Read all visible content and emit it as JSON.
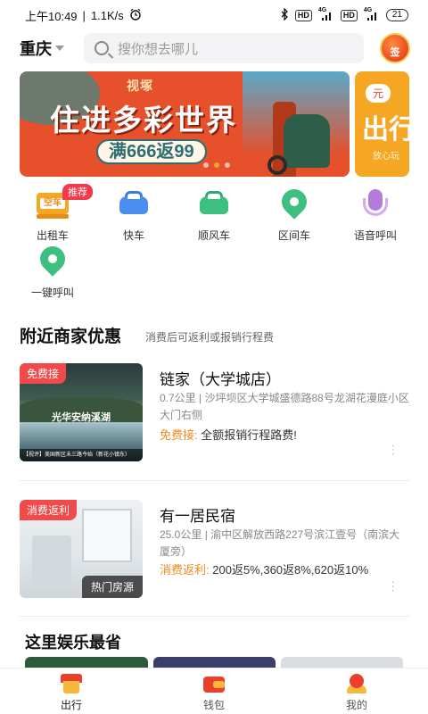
{
  "status_bar": {
    "time": "上午10:49",
    "speed": "1.1K/s",
    "icons": [
      "alarm-icon",
      "bluetooth-icon",
      "hd-icon",
      "signal-4g-icon",
      "hd-icon",
      "signal-4g-icon"
    ],
    "hd_label": "HD",
    "net_label": "4G",
    "battery": "21"
  },
  "header": {
    "city": "重庆",
    "search_placeholder": "搜你想去哪儿",
    "signin_label": "签"
  },
  "banner": {
    "brand": "视塚",
    "headline": "住进多彩世界",
    "promo": "满666返99",
    "next_tag": "元",
    "next_text": "出行",
    "next_sub": "放心玩",
    "active_dot": 2,
    "dot_count": 3
  },
  "services": [
    {
      "label": "出租车",
      "icon": "taxi-icon",
      "badge": "推荐",
      "color": "#f5a623",
      "sign": "空车"
    },
    {
      "label": "快车",
      "icon": "express-car-icon",
      "color": "#4a8ef0"
    },
    {
      "label": "顺风车",
      "icon": "carpool-car-icon",
      "color": "#3fbf7f"
    },
    {
      "label": "区间车",
      "icon": "route-pin-icon",
      "color": "#3fbf7f"
    },
    {
      "label": "语音呼叫",
      "icon": "microphone-icon",
      "color": "#b57bdc"
    },
    {
      "label": "一键呼叫",
      "icon": "one-tap-call-icon",
      "color": "#3fbf7f"
    }
  ],
  "nearby": {
    "title": "附近商家优惠",
    "subtitle": "消费后可返利或报销行程费",
    "shops": [
      {
        "tag": "免费接",
        "name": "链家（大学城店）",
        "address": "0.7公里 | 沙坪坝区大学城盛德路88号龙湖花漫庭小区大门右侧",
        "offer_key": "免费接:",
        "offer_value": "全额报销行程路费!",
        "thumb_caption": "光华安纳溪湖",
        "thumb_footer": "【视评】美国新区未三路今始（新花小镇东）"
      },
      {
        "tag": "消费返利",
        "name": "有一居民宿",
        "address": "25.0公里 | 渝中区解放西路227号滨江壹号（南滨大厦旁）",
        "offer_key": "消费返利:",
        "offer_value": "200返5%,360返8%,620返10%",
        "thumb_badge": "热门房源"
      }
    ]
  },
  "entertainment": {
    "title": "这里娱乐最省",
    "cards": [
      "#2d5a3a",
      "#3a3f6a",
      "#d8dde0"
    ]
  },
  "tabbar": {
    "tabs": [
      {
        "label": "出行",
        "icon": "home-travel-icon",
        "active": true
      },
      {
        "label": "钱包",
        "icon": "wallet-icon",
        "active": false
      },
      {
        "label": "我的",
        "icon": "profile-icon",
        "active": false
      }
    ]
  },
  "colors": {
    "accent_orange": "#f08a1c",
    "tag_red": "#f24a4a",
    "banner_bg": "#e6502a"
  }
}
